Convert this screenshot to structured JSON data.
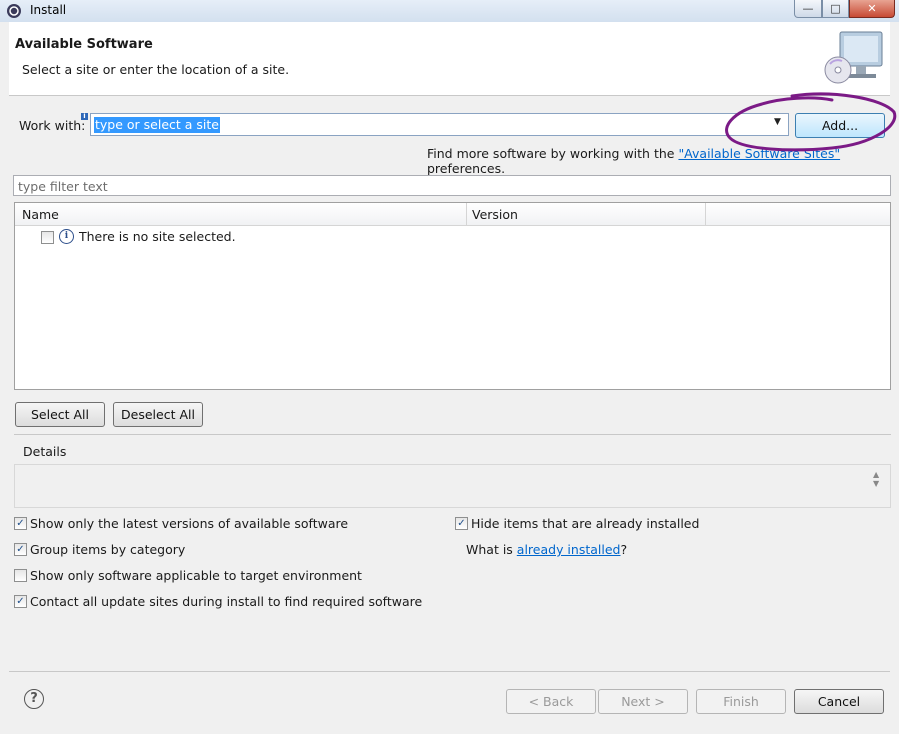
{
  "window": {
    "title": "Install"
  },
  "header": {
    "title": "Available Software",
    "subtitle": "Select a site or enter the location of a site."
  },
  "work_with": {
    "label": "Work with:",
    "value": "type or select a site",
    "add_label": "Add...",
    "find_more_prefix": "Find more software by working with the ",
    "find_more_link": "\"Available Software Sites\"",
    "find_more_suffix": " preferences."
  },
  "filter": {
    "placeholder": "type filter text"
  },
  "table": {
    "columns": [
      "Name",
      "Version"
    ],
    "message": "There is no site selected."
  },
  "selection": {
    "select_all": "Select All",
    "deselect_all": "Deselect All"
  },
  "details": {
    "label": "Details"
  },
  "options": {
    "latest_versions": {
      "label": "Show only the latest versions of available software",
      "checked": true
    },
    "group_by_category": {
      "label": "Group items by category",
      "checked": true
    },
    "target_env": {
      "label": "Show only software applicable to target environment",
      "checked": false
    },
    "contact_sites": {
      "label": "Contact all update sites during install to find required software",
      "checked": true
    },
    "hide_installed": {
      "label": "Hide items that are already installed",
      "checked": true
    },
    "what_is_prefix": "What is ",
    "what_is_link": "already installed",
    "what_is_suffix": "?"
  },
  "footer": {
    "back": "< Back",
    "next": "Next >",
    "finish": "Finish",
    "cancel": "Cancel"
  },
  "colors": {
    "annotation": "#7b1a86",
    "selection": "#3399ff",
    "link": "#0066cc"
  },
  "icons": [
    "app-icon",
    "monitor-cd-icon",
    "info-icon",
    "chevron-down-icon",
    "help-icon"
  ]
}
